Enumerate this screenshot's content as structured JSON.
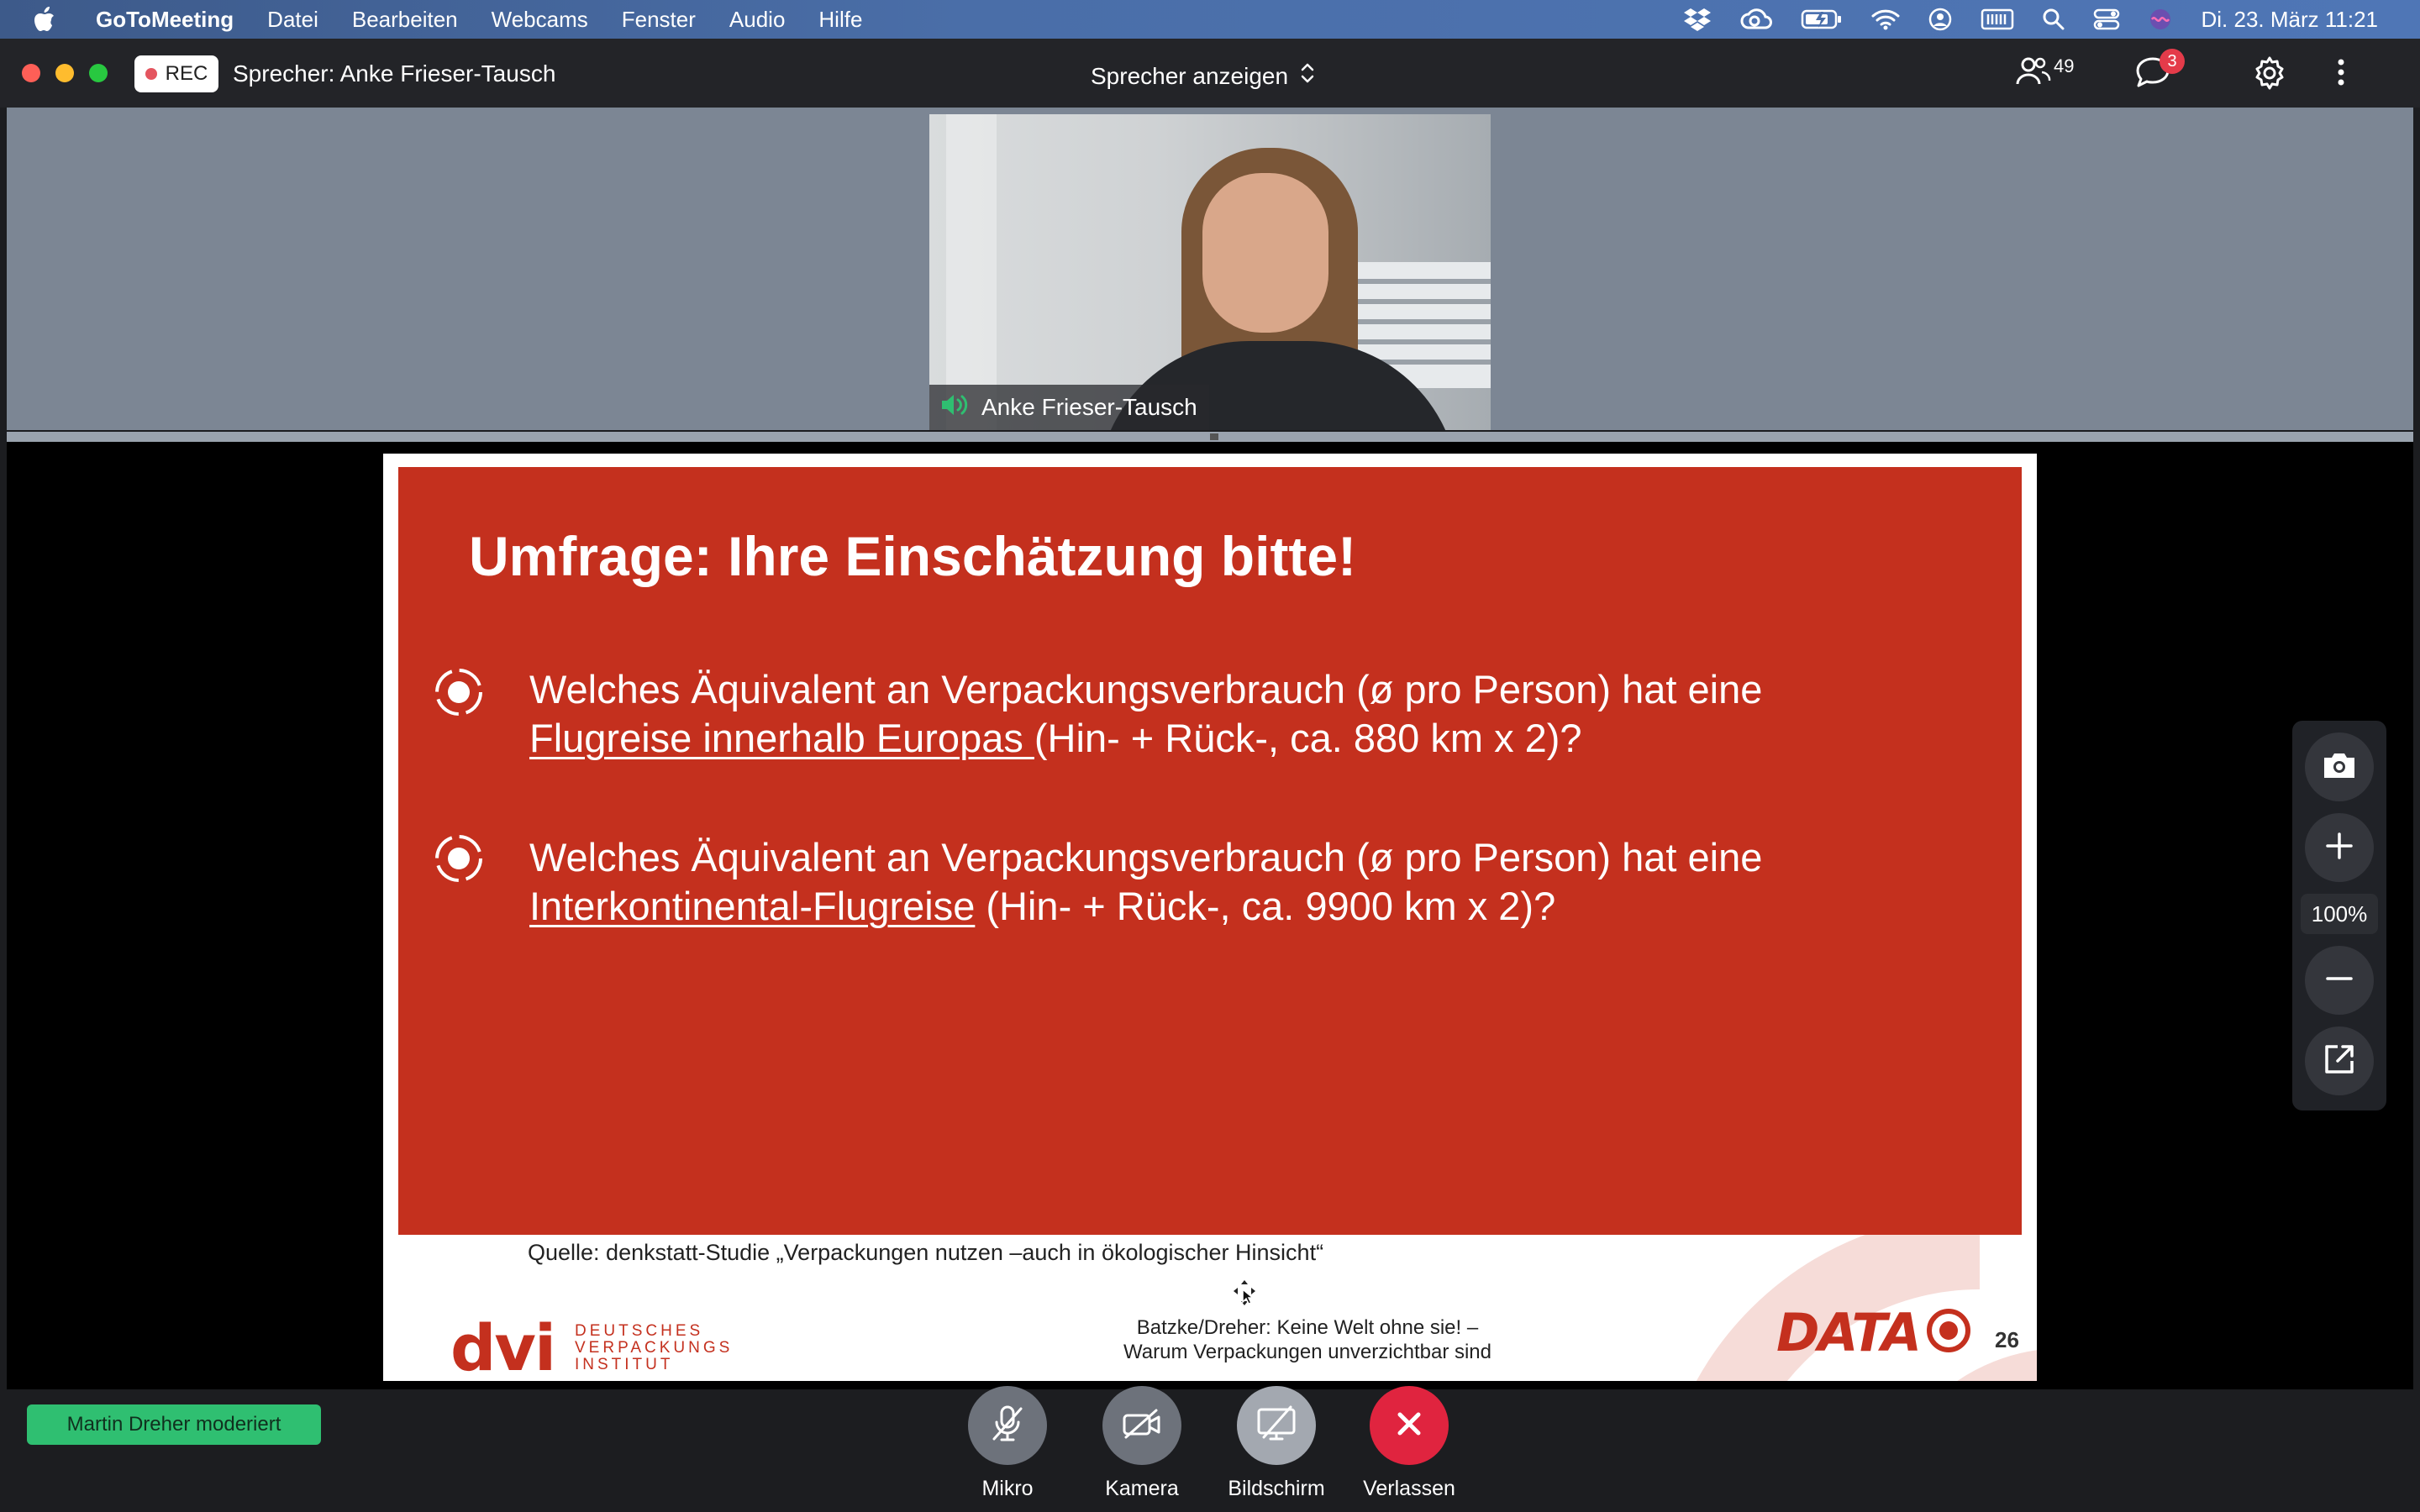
{
  "menubar": {
    "app_name": "GoToMeeting",
    "items": [
      "Datei",
      "Bearbeiten",
      "Webcams",
      "Fenster",
      "Audio",
      "Hilfe"
    ],
    "datetime": "Di. 23. März  11:21"
  },
  "titlebar": {
    "rec_label": "REC",
    "speaker_title": "Sprecher: Anke Frieser-Tausch",
    "view_selector": "Sprecher anzeigen",
    "participants_count": "49",
    "chat_badge": "3"
  },
  "video": {
    "name_tag": "Anke Frieser-Tausch"
  },
  "slide": {
    "title": "Umfrage: Ihre Einschätzung bitte!",
    "q1": {
      "line1": "Welches Äquivalent an Verpackungsverbrauch (ø pro Person) hat eine",
      "underlined": "Flugreise innerhalb Europas ",
      "rest": "(Hin- + Rück-, ca. 880 km x 2)?"
    },
    "q2": {
      "line1": "Welches Äquivalent an Verpackungsverbrauch (ø pro Person) hat eine",
      "underlined": "Interkontinental-Flugreise",
      "rest": " (Hin- + Rück-, ca. 9900 km x 2)?"
    },
    "source": "Quelle: denkstatt-Studie „Verpackungen nutzen –auch in ökologischer Hinsicht“",
    "dvi_mark": "dvi",
    "dvi_text": [
      "DEUTSCHES",
      "VERPACKUNGS",
      "INSTITUT"
    ],
    "footer_line1": "Batzke/Dreher: Keine Welt ohne sie! –",
    "footer_line2": "Warum Verpackungen unverzichtbar sind",
    "data_mark": "DATA",
    "page_number": "26"
  },
  "zoom": {
    "level": "100%"
  },
  "bottombar": {
    "moderator": "Martin Dreher moderiert",
    "controls": {
      "mic": "Mikro",
      "camera": "Kamera",
      "screen": "Bildschirm",
      "leave": "Verlassen"
    }
  },
  "colors": {
    "slide_red": "#c4301e",
    "leave_red": "#e0243f",
    "moderator_green": "#2fbf71"
  }
}
